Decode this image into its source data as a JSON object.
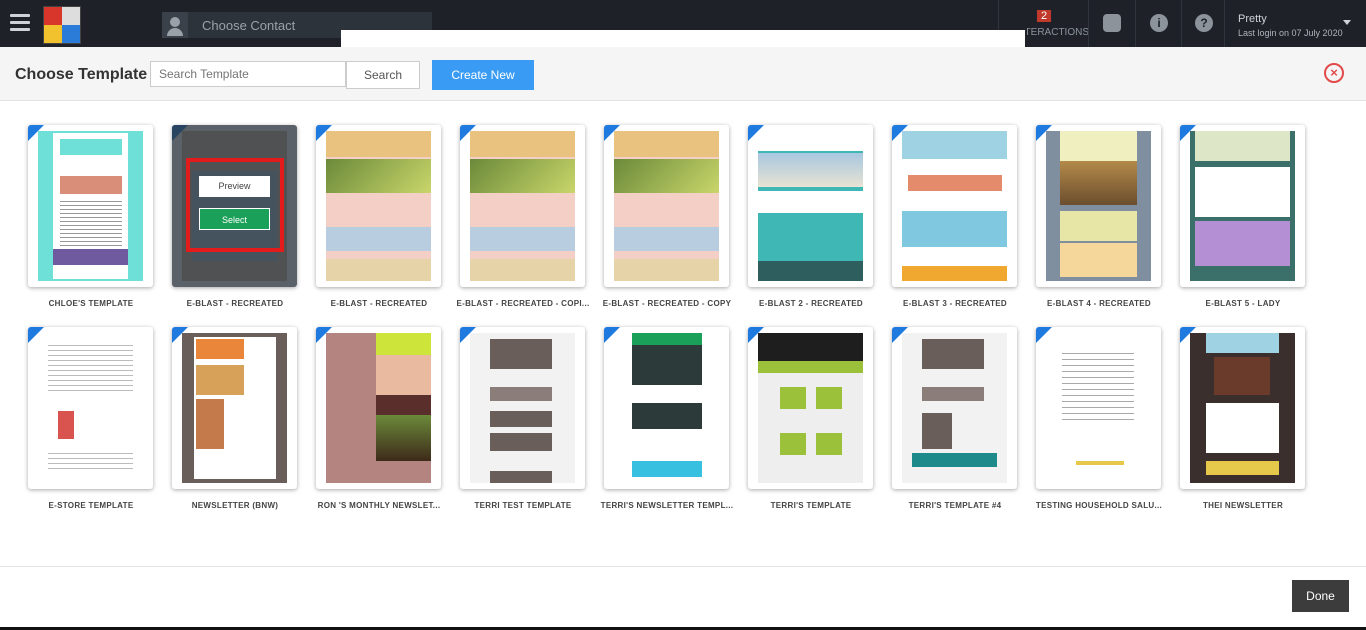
{
  "topbar": {
    "contact_placeholder": "Choose Contact",
    "interactions_count": "2",
    "interactions_label": "INTERACTIONS",
    "user_name": "Pretty",
    "last_login": "Last login on 07 July 2020"
  },
  "modal": {
    "title": "Choose Template",
    "search_placeholder": "Search Template",
    "search_label": "Search",
    "create_label": "Create New",
    "done_label": "Done",
    "preview_label": "Preview",
    "select_label": "Select"
  },
  "templates": [
    {
      "name": "CHLOE'S TEMPLATE",
      "bg": "#6fe0d8",
      "style": "teal"
    },
    {
      "name": "E-BLAST - RECREATED",
      "bg": "#7a8a8a",
      "style": "hover"
    },
    {
      "name": "E-BLAST - RECREATED",
      "bg": "#f3cfc5",
      "style": "eblast"
    },
    {
      "name": "E-BLAST - RECREATED - COPI...",
      "bg": "#f3cfc5",
      "style": "eblast"
    },
    {
      "name": "E-BLAST - RECREATED - COPY",
      "bg": "#f3cfc5",
      "style": "eblast"
    },
    {
      "name": "E-BLAST 2 - RECREATED",
      "bg": "#3fb8b5",
      "style": "teal2"
    },
    {
      "name": "E-BLAST 3 - RECREATED",
      "bg": "#9fd3e4",
      "style": "blue"
    },
    {
      "name": "E-BLAST 4 - RECREATED",
      "bg": "#7f8f9f",
      "style": "slate"
    },
    {
      "name": "E-BLAST 5 - LADY",
      "bg": "#3b6f6a",
      "style": "green"
    },
    {
      "name": "E-STORE TEMPLATE",
      "bg": "#ffffff",
      "style": "store"
    },
    {
      "name": "NEWSLETTER (BNW)",
      "bg": "#6a5e5a",
      "style": "bnw"
    },
    {
      "name": "RON 'S MONTHLY NEWSLET...",
      "bg": "#b38480",
      "style": "ron"
    },
    {
      "name": "TERRI TEST TEMPLATE",
      "bg": "#f2f2f2",
      "style": "terri"
    },
    {
      "name": "TERRI'S NEWSLETTER TEMPL...",
      "bg": "#2c3b3a",
      "style": "fund"
    },
    {
      "name": "TERRI'S TEMPLATE",
      "bg": "#1e1e1e",
      "style": "terris"
    },
    {
      "name": "TERRI'S TEMPLATE #4",
      "bg": "#f2f2f2",
      "style": "terri4"
    },
    {
      "name": "TESTING HOUSEHOLD SALU...",
      "bg": "#ffffff",
      "style": "text"
    },
    {
      "name": "THEI NEWSLETTER",
      "bg": "#3a2f2c",
      "style": "thei"
    }
  ]
}
